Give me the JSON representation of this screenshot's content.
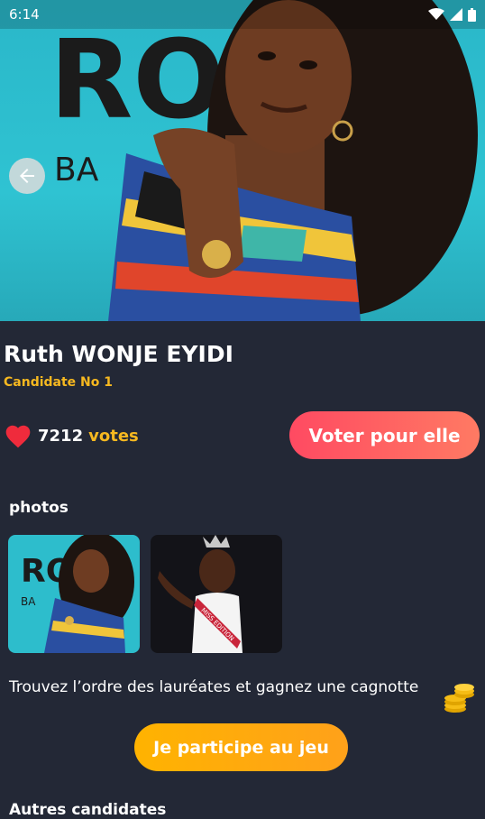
{
  "status": {
    "time": "6:14"
  },
  "candidate": {
    "name": "Ruth WONJE EYIDI",
    "number_label": "Candidate No 1",
    "votes_count": "7212",
    "votes_word": "votes",
    "vote_button": "Voter pour elle"
  },
  "hero": {
    "sign_letters": "RO",
    "sign_sub": "BA"
  },
  "photos": {
    "title": "photos",
    "items": [
      {
        "alt": "photo-1",
        "sign_letters": "RO",
        "sign_sub": "BA"
      },
      {
        "alt": "photo-2",
        "sash_text": "MISS EDITION"
      }
    ]
  },
  "game": {
    "text": "Trouvez l’ordre des lauréates et gagnez une cagnotte",
    "button": "Je participe au jeu"
  },
  "next_section": {
    "title": "Autres candidates"
  },
  "colors": {
    "accent_yellow": "#f6b820",
    "vote_gradient": [
      "#ff4a62",
      "#ff7a63"
    ],
    "play_gradient": [
      "#ffb300",
      "#ffa11a"
    ],
    "background": "#232836"
  }
}
